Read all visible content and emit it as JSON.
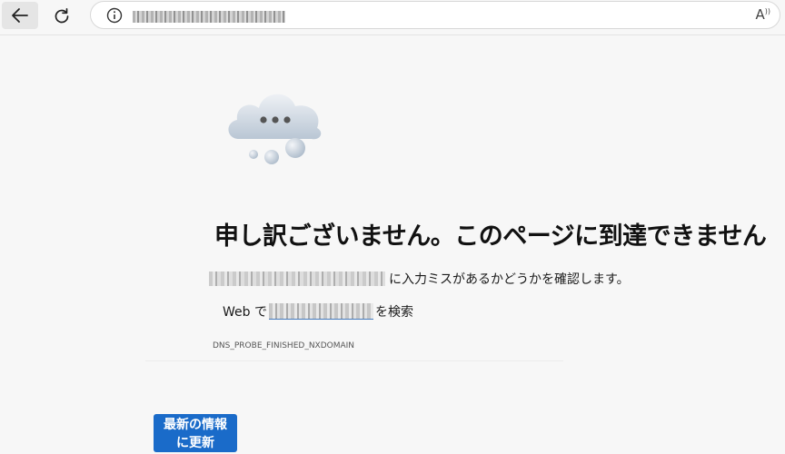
{
  "toolbar": {
    "back_icon": "arrow-left-icon",
    "reload_icon": "reload-icon",
    "info_icon": "info-icon",
    "read_aloud_icon": "read-aloud-icon",
    "read_aloud_glyph": "A",
    "read_aloud_sup": "))"
  },
  "error": {
    "illustration_icon": "cloud-icon",
    "heading": "申し訳ございません。このページに到達できません",
    "description_suffix": "に入力ミスがあるかどうかを確認します。",
    "search_prefix": "Web で",
    "search_suffix": "を検索",
    "code": "DNS_PROBE_FINISHED_NXDOMAIN"
  },
  "refresh_button": {
    "line1": "最新の情報",
    "line2": "に更新"
  },
  "colors": {
    "background": "#f7f7f7",
    "button": "#1a6bc9",
    "link": "#1a5fb4"
  }
}
